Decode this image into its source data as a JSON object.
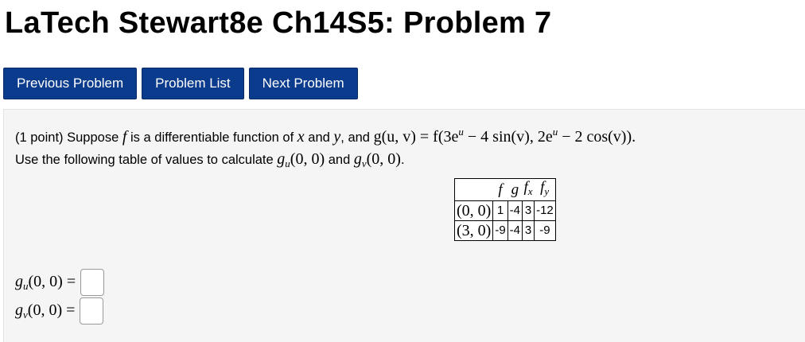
{
  "page": {
    "title": "LaTech Stewart8e Ch14S5: Problem 7"
  },
  "nav": {
    "previous_label": "Previous Problem",
    "list_label": "Problem List",
    "next_label": "Next Problem"
  },
  "problem": {
    "points": "(1 point)",
    "text_suppose": "Suppose",
    "text_is_diff": "is a differentiable function of",
    "text_and": "and",
    "text_and2": "and",
    "line2_text": "Use the following table of values to calculate",
    "and_word": "and",
    "func_f": "f",
    "var_x": "x",
    "var_y": "y",
    "definition": "g(u, v) = f(3e",
    "definition_exp": "u",
    "definition_mid": " − 4 sin(v), 2e",
    "definition_exp2": "u",
    "definition_end": " − 2 cos(v)).",
    "g_u_target": "(0, 0)",
    "g_v_target": "(0, 0)",
    "period": "."
  },
  "table": {
    "headers": [
      "",
      "f",
      "g",
      "fx",
      "fy"
    ],
    "rows": [
      {
        "point": "(0, 0)",
        "f": "1",
        "g": "-4",
        "fx": "3",
        "fy": "-12"
      },
      {
        "point": "(3, 0)",
        "f": "-9",
        "g": "-4",
        "fx": "3",
        "fy": "-9"
      }
    ]
  },
  "answers": {
    "gu_label_arg": "(0, 0) =",
    "gv_label_arg": "(0, 0) =",
    "gu_value": "",
    "gv_value": ""
  }
}
